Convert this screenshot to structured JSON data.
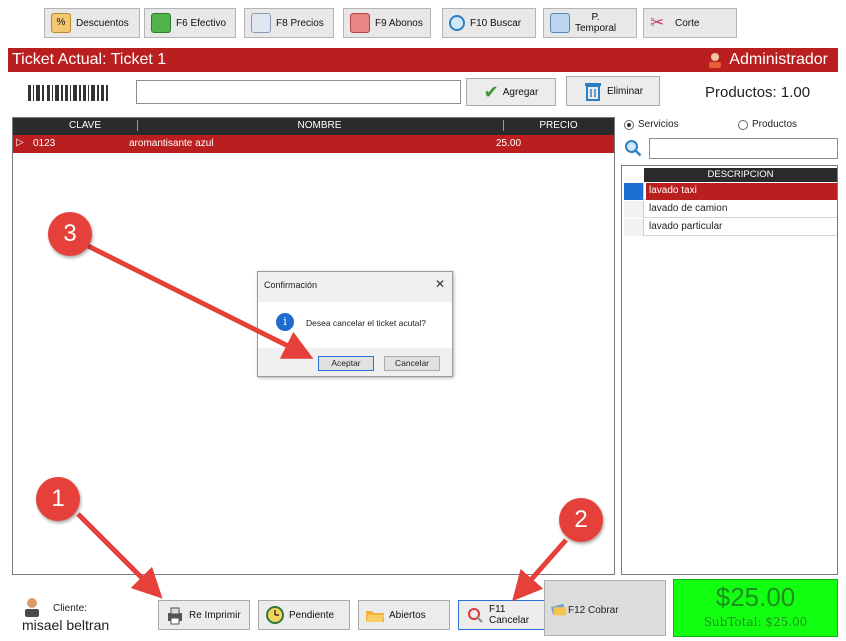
{
  "toolbar": {
    "descuentos": "Descuentos",
    "efectivo": "F6 Efectivo",
    "precios": "F8 Precios",
    "abonos": "F9 Abonos",
    "buscar": "F10 Buscar",
    "temporal_line1": "P.",
    "temporal_line2": "Temporal",
    "corte": "Corte"
  },
  "header": {
    "title": "Ticket Actual: Ticket 1",
    "user": "Administrador"
  },
  "scan": {
    "agregar": "Agregar",
    "eliminar": "Eliminar",
    "productos": "Productos: 1.00"
  },
  "table": {
    "columns": [
      "CLAVE",
      "NOMBRE",
      "PRECIO"
    ],
    "rows": [
      {
        "clave": "0123",
        "nombre": "aromantisante azul",
        "precio": "25.00"
      }
    ]
  },
  "right_panel": {
    "radio_servicios": "Servicios",
    "radio_productos": "Productos",
    "selected": "Servicios",
    "column": "DESCRIPCION",
    "items": [
      "lavado taxi",
      "lavado de camion",
      "lavado particular"
    ]
  },
  "dialog": {
    "title": "Confirmación",
    "message": "Desea cancelar el ticket acutal?",
    "accept": "Aceptar",
    "cancel": "Cancelar",
    "close": "✕",
    "info_glyph": "i"
  },
  "bottom": {
    "cliente_label": "Cliente:",
    "cliente_name": "misael beltran",
    "reimprimir": "Re Imprimir",
    "pendiente": "Pendiente",
    "abiertos": "Abiertos",
    "cancelar_line1": "F11",
    "cancelar_line2": "Cancelar",
    "cobrar": "F12 Cobrar",
    "total": "$25.00",
    "subtotal": "SubTotal: $25.00"
  },
  "annotations": {
    "marker_1": "1",
    "marker_2": "2",
    "marker_3": "3"
  },
  "colors": {
    "header_red": "#b91f1f",
    "total_green": "#12ff12",
    "marker_red": "#e6403a"
  }
}
